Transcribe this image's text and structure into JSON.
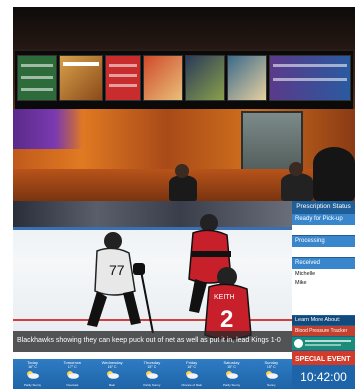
{
  "signage": {
    "ticker": "Blackhawks showing they can keep puck out of net as well as put it in, lead Kings 1-0",
    "prescription": {
      "title": "Prescription Status",
      "ready": "Ready for Pick-up",
      "processing": "Processing",
      "received": "Received",
      "names": [
        "Michelle",
        "Mike"
      ]
    },
    "learn_more": "Learn More About:",
    "blood_pressure": "Blood Pressure Tracker",
    "special_event": "SPECIAL EVENT",
    "clock": "10:42:00",
    "forecast": [
      {
        "day": "Today",
        "temp": "16° C",
        "cond": "Partly Sunny"
      },
      {
        "day": "Tomorrow",
        "temp": "17° C",
        "cond": "Overcast"
      },
      {
        "day": "Wednesday",
        "temp": "16° C",
        "cond": "Rain"
      },
      {
        "day": "Thursday",
        "temp": "15° C",
        "cond": "Partly Sunny"
      },
      {
        "day": "Friday",
        "temp": "16° C",
        "cond": "Chance of Rain"
      },
      {
        "day": "Saturday",
        "temp": "15° C",
        "cond": "Partly Sunny"
      },
      {
        "day": "Sunday",
        "temp": "15° C",
        "cond": "Sunny"
      }
    ],
    "colors": {
      "panel": "#1f5e97",
      "weather": "#2f7cc4",
      "special": "#d23b2a",
      "bp": "#c2402d"
    }
  },
  "photo": {
    "board_colors": [
      "#2d6b3a",
      "#d8a14a",
      "#c82c2c",
      "#b03a2a",
      "#2a3a5a",
      "#3a6a8a",
      "#5a3a8a"
    ]
  }
}
